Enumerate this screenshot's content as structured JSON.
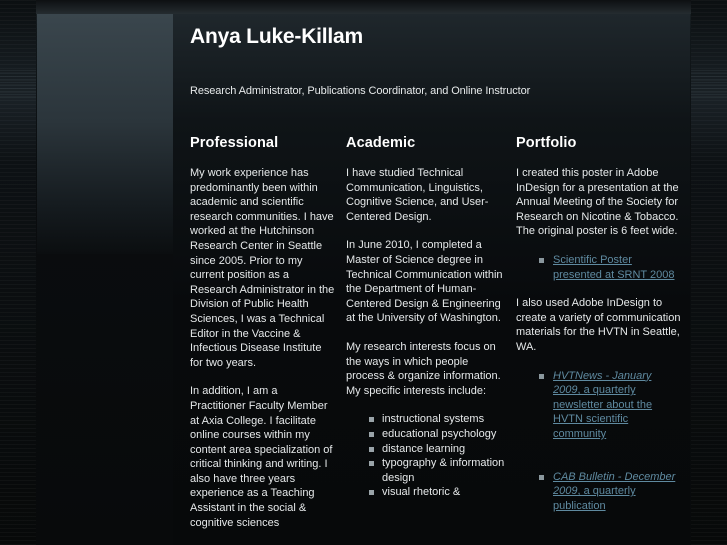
{
  "header": {
    "name": "Anya Luke-Killam",
    "tagline": "Research Administrator, Publications Coordinator, and Online Instructor"
  },
  "professional": {
    "heading": "Professional",
    "paragraphs": [
      "My work experience has predominantly been within academic and scientific research communities. I have worked at the Hutchinson Research Center in Seattle since 2005. Prior to my current position as a Research Administrator in the Division of Public Health Sciences, I was a Technical Editor in the Vaccine & Infectious Disease Institute for two years.",
      "In addition, I am a Practitioner Faculty Member at Axia College. I facilitate online courses within my content area specialization of critical thinking and writing. I also have three years experience as a Teaching Assistant in the social & cognitive sciences"
    ]
  },
  "academic": {
    "heading": "Academic",
    "paragraphs": [
      "I have studied Technical Communication, Linguistics, Cognitive Science, and User-Centered Design.",
      "In June 2010, I completed a Master of Science degree in Technical Communication within the Department of Human-Centered Design & Engineering at the University of Washington.",
      "My research interests focus on the ways in which people process & organize information. My specific interests include:"
    ],
    "interests": [
      "instructional systems",
      "educational psychology",
      "distance learning",
      "typography & information design",
      "visual rhetoric &"
    ]
  },
  "portfolio": {
    "heading": "Portfolio",
    "intro": "I created this poster in Adobe InDesign for a presentation at the Annual Meeting of the Society for Research on Nicotine & Tobacco. The original poster is 6 feet wide.",
    "poster_link": "Scientific Poster presented at SRNT 2008",
    "middle": "I also used Adobe InDesign to create a variety of communication materials for the HVTN in Seattle, WA.",
    "hvtn_title": "HVTNews - January 2009",
    "hvtn_rest": ", a quarterly newsletter about the HVTN scientific community",
    "cab_title": "CAB Bulletin - December 2009",
    "cab_rest": ", a quarterly publication"
  }
}
